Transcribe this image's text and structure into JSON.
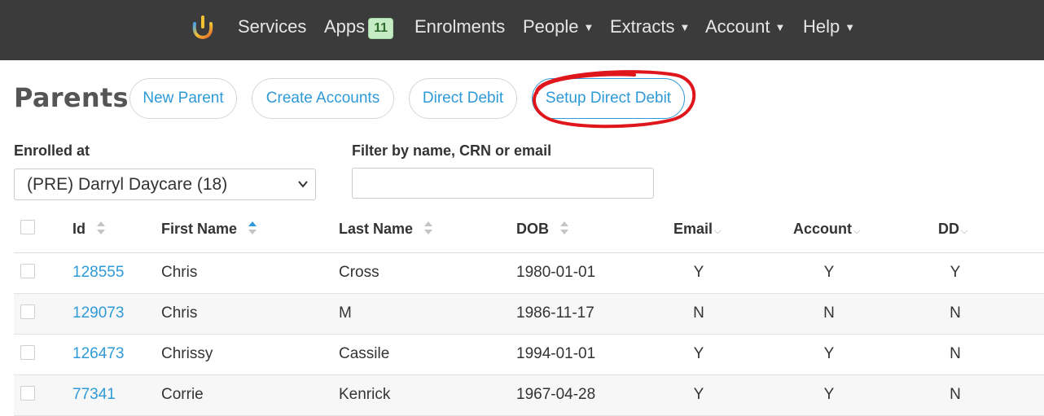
{
  "nav": {
    "items": [
      {
        "label": "Services"
      },
      {
        "label": "Apps",
        "badge": "11"
      },
      {
        "label": "Enrolments"
      },
      {
        "label": "People",
        "caret": "▼"
      },
      {
        "label": "Extracts",
        "caret": "▼"
      },
      {
        "label": "Account",
        "caret": "▼"
      },
      {
        "label": "Help",
        "caret": "▼"
      }
    ]
  },
  "page": {
    "title": "Parents",
    "buttons": [
      "New Parent",
      "Create Accounts",
      "Direct Debit",
      "Setup Direct Debit"
    ]
  },
  "filters": {
    "enrolled_label": "Enrolled at",
    "enrolled_value": "(PRE) Darryl Daycare (18)",
    "filter_label": "Filter by name, CRN or email",
    "filter_value": ""
  },
  "table": {
    "headers": [
      "Id",
      "First Name",
      "Last Name",
      "DOB",
      "Email",
      "Account",
      "DD"
    ],
    "rows": [
      {
        "id": "128555",
        "first": "Chris",
        "last": "Cross",
        "dob": "1980-01-01",
        "email": "Y",
        "account": "Y",
        "dd": "Y"
      },
      {
        "id": "129073",
        "first": "Chris",
        "last": "M",
        "dob": "1986-11-17",
        "email": "N",
        "account": "N",
        "dd": "N"
      },
      {
        "id": "126473",
        "first": "Chrissy",
        "last": "Cassile",
        "dob": "1994-01-01",
        "email": "Y",
        "account": "Y",
        "dd": "N"
      },
      {
        "id": "77341",
        "first": "Corrie",
        "last": "Kenrick",
        "dob": "1967-04-28",
        "email": "Y",
        "account": "Y",
        "dd": "N"
      }
    ]
  },
  "colors": {
    "navbar": "#3b3b3b",
    "link": "#2e9ad8",
    "badge_bg": "#c5ecc5",
    "annotation": "#e0161d"
  },
  "icons": {
    "logo": "hand-logo-icon",
    "sort": "sort-icon",
    "dropdown": "chevron-down-icon"
  }
}
